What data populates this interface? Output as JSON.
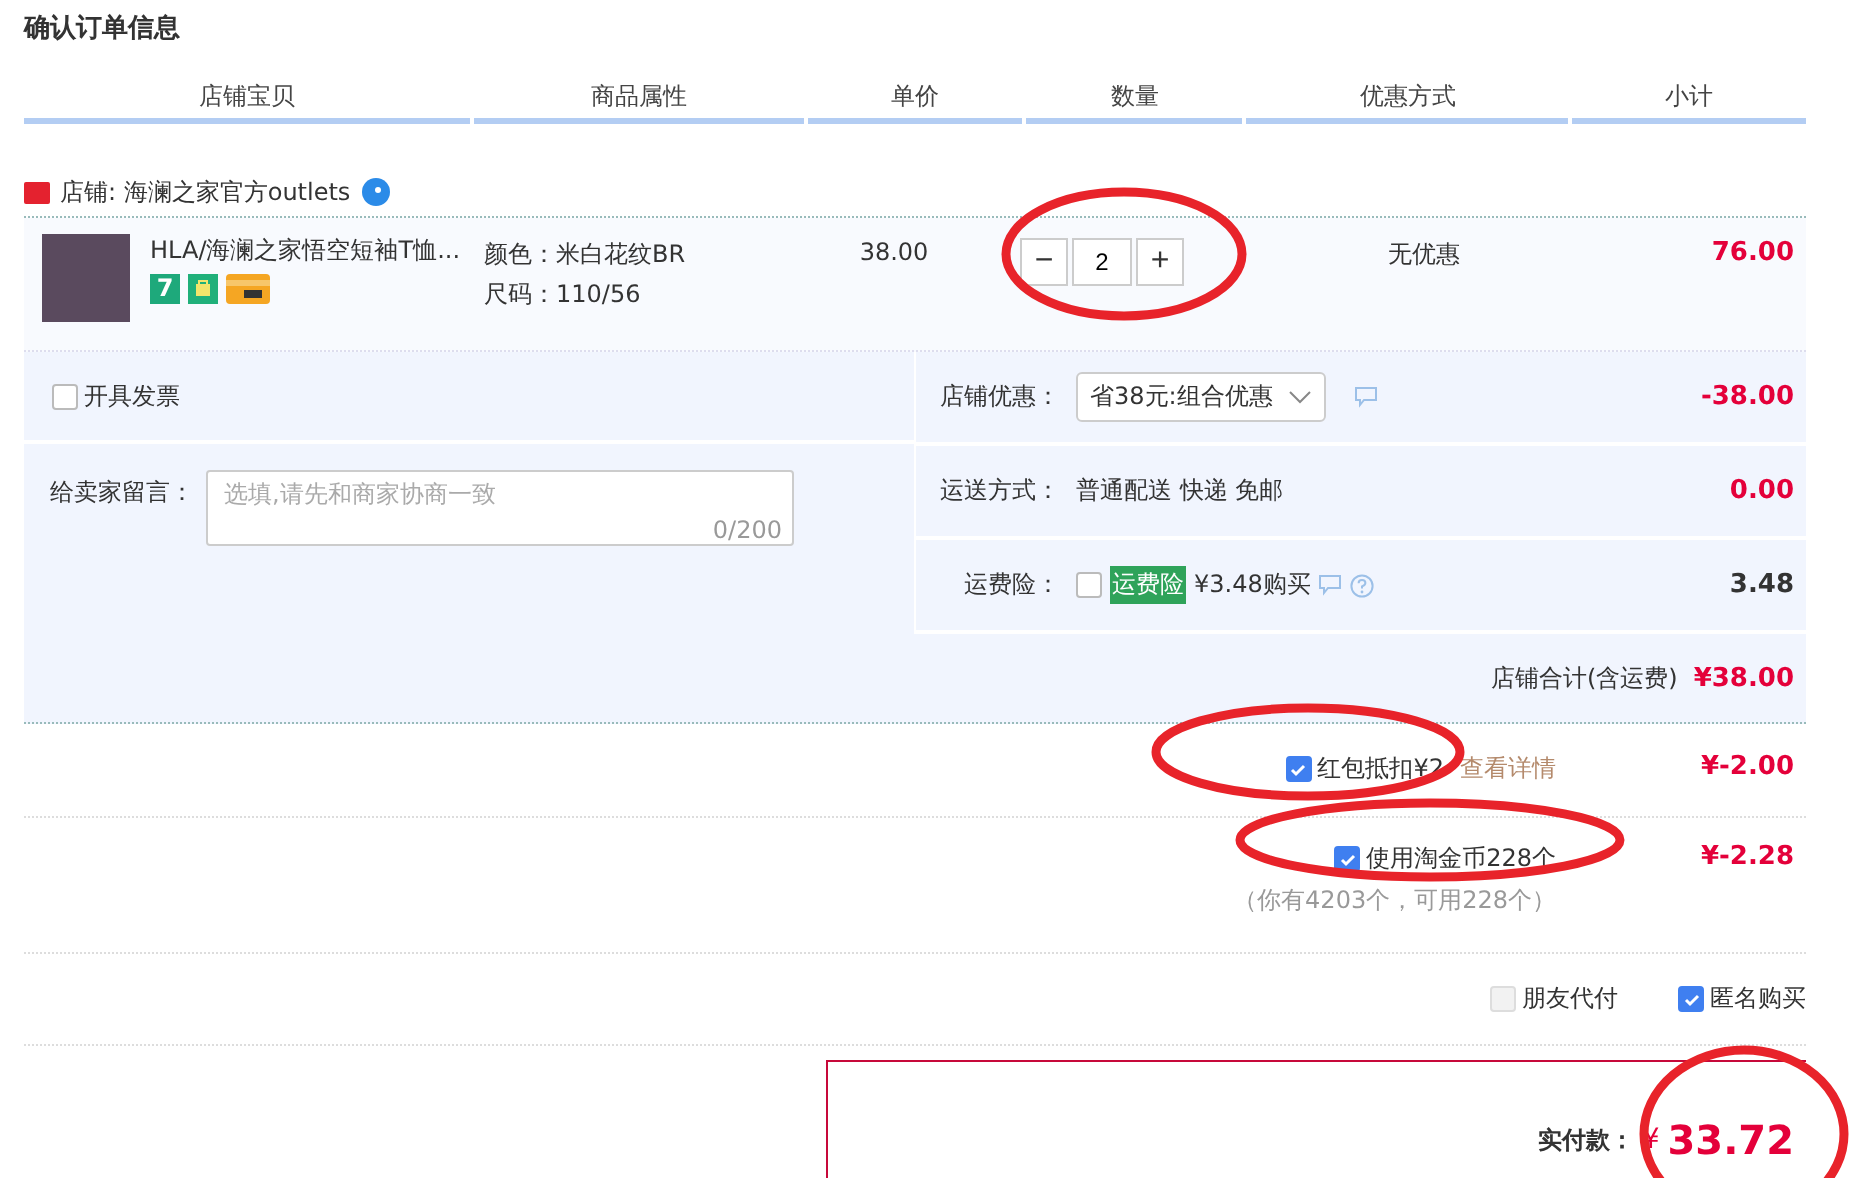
{
  "title": "确认订单信息",
  "columns": [
    "店铺宝贝",
    "商品属性",
    "单价",
    "数量",
    "优惠方式",
    "小计"
  ],
  "shop": {
    "name": "店铺: 海澜之家官方outlets"
  },
  "item": {
    "name": "HLA/海澜之家悟空短袖T恤...",
    "badge": "7",
    "attributes": [
      "颜色：米白花纹BR",
      "尺码：110/56"
    ],
    "price": "38.00",
    "quantity": "2",
    "minus": "−",
    "plus": "+",
    "discount": "无优惠",
    "subtotal": "76.00"
  },
  "invoice": {
    "label": "开具发票",
    "checked": false
  },
  "message": {
    "label": "给卖家留言：",
    "placeholder": "选填,请先和商家协商一致",
    "counter": "0/200"
  },
  "shop_discount": {
    "label": "店铺优惠：",
    "value": "省38元:组合优惠",
    "amount": "-38.00"
  },
  "shipping": {
    "label": "运送方式：",
    "value": "普通配送 快递 免邮",
    "amount": "0.00"
  },
  "insurance": {
    "label": "运费险：",
    "checked": false,
    "tag": "运费险",
    "value": "¥3.48购买",
    "amount": "3.48"
  },
  "shop_total": {
    "label": "店铺合计(含运费)",
    "amount": "¥38.00"
  },
  "red_packet": {
    "label": "红包抵扣¥2",
    "checked": true,
    "link": "查看详情",
    "amount": "¥-2.00"
  },
  "coins": {
    "label": "使用淘金币228个",
    "checked": true,
    "note": "（你有4203个，可用228个）",
    "amount": "¥-2.28"
  },
  "options": [
    {
      "label": "朋友代付",
      "checked": false,
      "disabled": true
    },
    {
      "label": "匿名购买",
      "checked": true,
      "disabled": false
    }
  ],
  "payment": {
    "label": "实付款：",
    "currency": "¥",
    "amount": "33.72"
  }
}
